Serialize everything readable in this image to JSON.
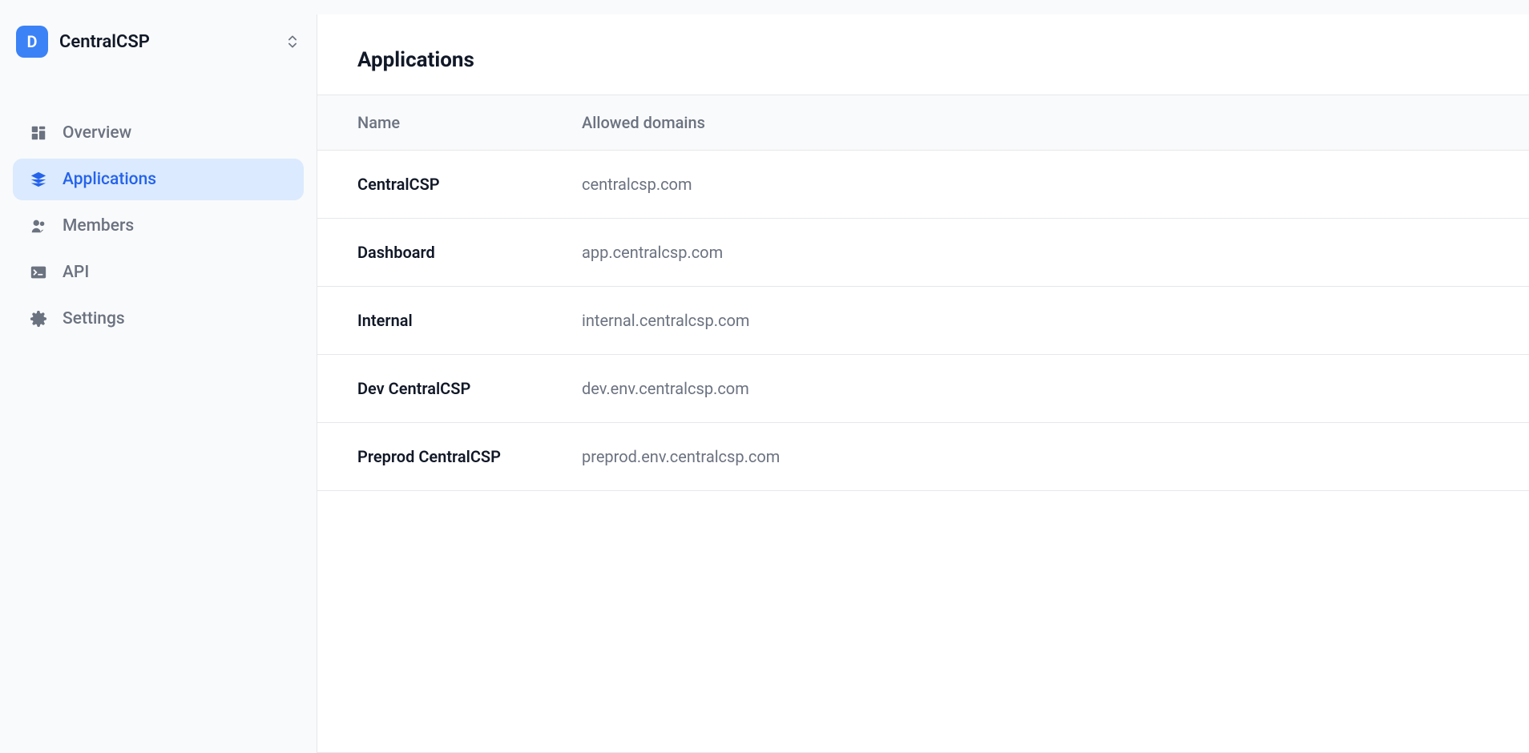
{
  "org": {
    "initial": "D",
    "name": "CentralCSP"
  },
  "sidebar": {
    "items": [
      {
        "label": "Overview"
      },
      {
        "label": "Applications"
      },
      {
        "label": "Members"
      },
      {
        "label": "API"
      },
      {
        "label": "Settings"
      }
    ]
  },
  "page": {
    "title": "Applications"
  },
  "table": {
    "columns": {
      "name": "Name",
      "domain": "Allowed domains"
    },
    "rows": [
      {
        "name": "CentralCSP",
        "domain": "centralcsp.com"
      },
      {
        "name": "Dashboard",
        "domain": "app.centralcsp.com"
      },
      {
        "name": "Internal",
        "domain": "internal.centralcsp.com"
      },
      {
        "name": "Dev CentralCSP",
        "domain": "dev.env.centralcsp.com"
      },
      {
        "name": "Preprod CentralCSP",
        "domain": "preprod.env.centralcsp.com"
      }
    ]
  }
}
